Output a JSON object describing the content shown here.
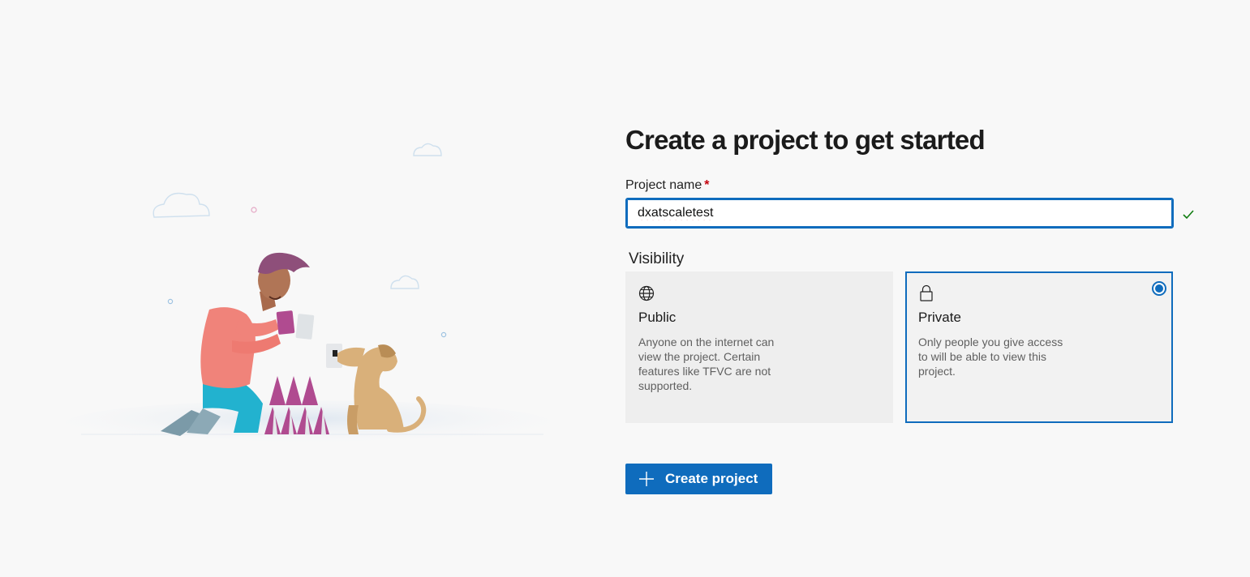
{
  "page": {
    "title": "Create a project to get started"
  },
  "project_name": {
    "label": "Project name",
    "required_marker": "*",
    "value": "dxatscaletest"
  },
  "visibility": {
    "label": "Visibility",
    "options": [
      {
        "id": "public",
        "icon": "globe-icon",
        "title": "Public",
        "description": "Anyone on the internet can view the project. Certain features like TFVC are not supported.",
        "selected": false
      },
      {
        "id": "private",
        "icon": "lock-icon",
        "title": "Private",
        "description": "Only people you give access to will be able to view this project.",
        "selected": true
      }
    ]
  },
  "actions": {
    "create_label": "Create project",
    "create_icon": "plus-icon"
  },
  "colors": {
    "accent": "#0f6cbd",
    "required": "#c4000d",
    "valid": "#107c10",
    "background": "#f8f8f8"
  }
}
